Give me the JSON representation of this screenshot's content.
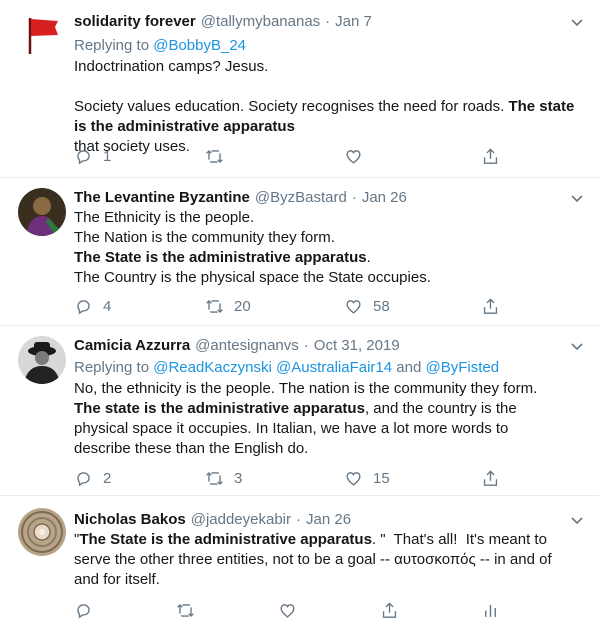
{
  "tweets": [
    {
      "name": "solidarity forever",
      "handle": "@tallymybananas",
      "dot": "·",
      "date": "Jan 7",
      "avatar_icon": "red-flag-icon",
      "replying_prefix": "Replying to",
      "replying_to": "@BobbyB_24",
      "lines": [
        "Indoctrination camps? Jesus.",
        "",
        "Society values education. Society recognises the need for roads.",
        "The state is the administrative apparatus",
        "that society uses."
      ],
      "reply_count": "1",
      "retweet_count": "",
      "like_count": ""
    },
    {
      "name": "The Levantine Byzantine",
      "handle": "@ByzBastard",
      "dot": "·",
      "date": "Jan 26",
      "avatar_icon": "photo-avatar-icon",
      "lines": [
        "The Ethnicity is the people.",
        "The Nation is the community they form.",
        "The State is the administrative apparatus",
        ".",
        "The Country is the physical space the State occupies."
      ],
      "reply_count": "4",
      "retweet_count": "20",
      "like_count": "58"
    },
    {
      "name": "Camicia Azzurra",
      "handle": "@antesignanvs",
      "dot": "·",
      "date": "Oct 31, 2019",
      "avatar_icon": "photo-avatar-icon",
      "replying_prefix": "Replying to",
      "replying_to": "@ReadKaczynski @AustraliaFair14",
      "replying_and": "and",
      "replying_to_2": "@ByFisted",
      "lines": [
        "No, the ethnicity is the people. The nation is the community they form.",
        "The state is the administrative apparatus",
        ", and the country is the",
        "physical space it occupies. In Italian, we have a lot more words to",
        "describe these than the English do."
      ],
      "reply_count": "2",
      "retweet_count": "3",
      "like_count": "15"
    },
    {
      "name": "Nicholas Bakos",
      "handle": "@jaddeyekabir",
      "dot": "·",
      "date": "Jan 26",
      "avatar_icon": "dome-avatar-icon",
      "lines": [
        "\"",
        "The State is the administrative apparatus",
        ". \"  That's all!  It's meant to",
        "serve the other three entities, not to be a goal -- αυτοσκοπός  -- in and of",
        "and for itself."
      ],
      "reply_count": "",
      "retweet_count": "",
      "like_count": ""
    }
  ],
  "colors": {
    "name": "#14171a",
    "secondary": "#657786",
    "link": "#1b95e0",
    "divider": "#e6ecf0",
    "flag_red": "#d62020"
  }
}
